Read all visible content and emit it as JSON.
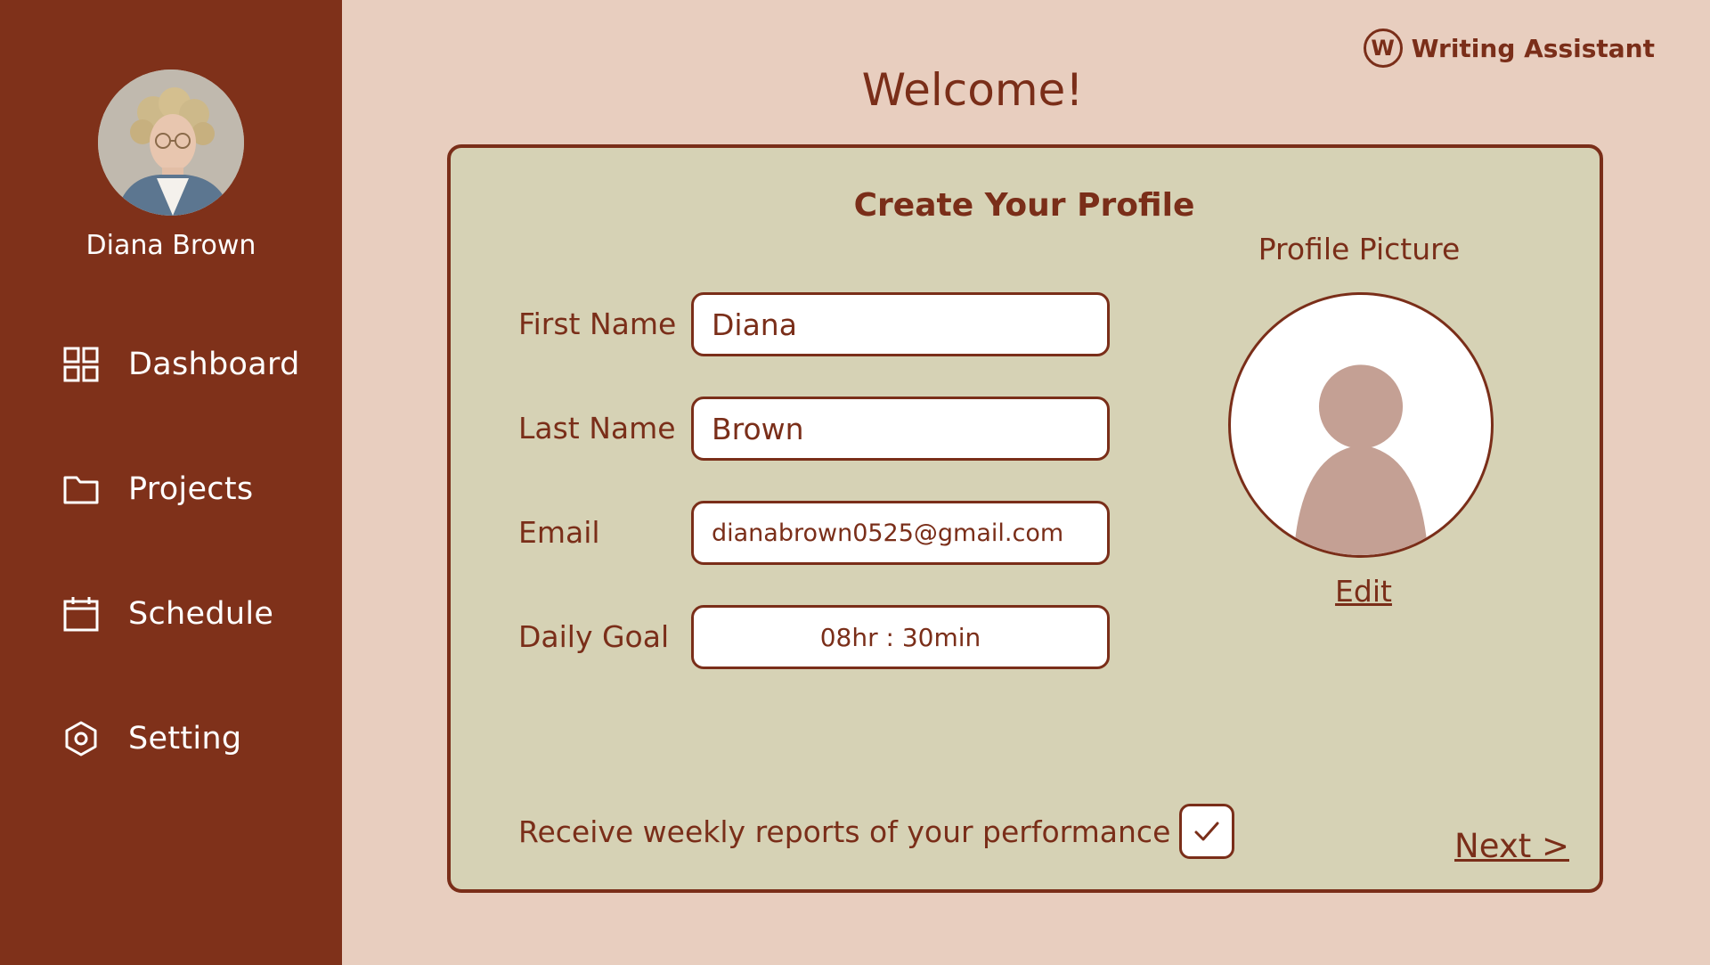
{
  "sidebar": {
    "user_name": "Diana Brown",
    "items": [
      {
        "label": "Dashboard",
        "icon": "grid-icon"
      },
      {
        "label": "Projects",
        "icon": "folder-icon"
      },
      {
        "label": "Schedule",
        "icon": "calendar-icon"
      },
      {
        "label": "Setting",
        "icon": "settings-icon"
      }
    ]
  },
  "brand": {
    "logo_letter": "W",
    "name": "Writing Assistant"
  },
  "header": {
    "title": "Welcome!"
  },
  "profile_form": {
    "title": "Create Your Profile",
    "fields": {
      "first_name": {
        "label": "First Name",
        "value": "Diana"
      },
      "last_name": {
        "label": "Last Name",
        "value": "Brown"
      },
      "email": {
        "label": "Email",
        "value": "dianabrown0525@gmail.com"
      },
      "daily_goal": {
        "label": "Daily Goal",
        "value": "08hr : 30min"
      }
    },
    "profile_picture": {
      "label": "Profile Picture",
      "edit_label": "Edit"
    },
    "weekly_reports": {
      "label": "Receive weekly reports of your performance",
      "checked": true
    },
    "next_label": "Next >"
  },
  "colors": {
    "sidebar_bg": "#7F311A",
    "page_bg": "#E8CEBF",
    "card_bg": "#D6D2B5",
    "accent": "#7A2E19",
    "placeholder_avatar": "#C4A094"
  }
}
